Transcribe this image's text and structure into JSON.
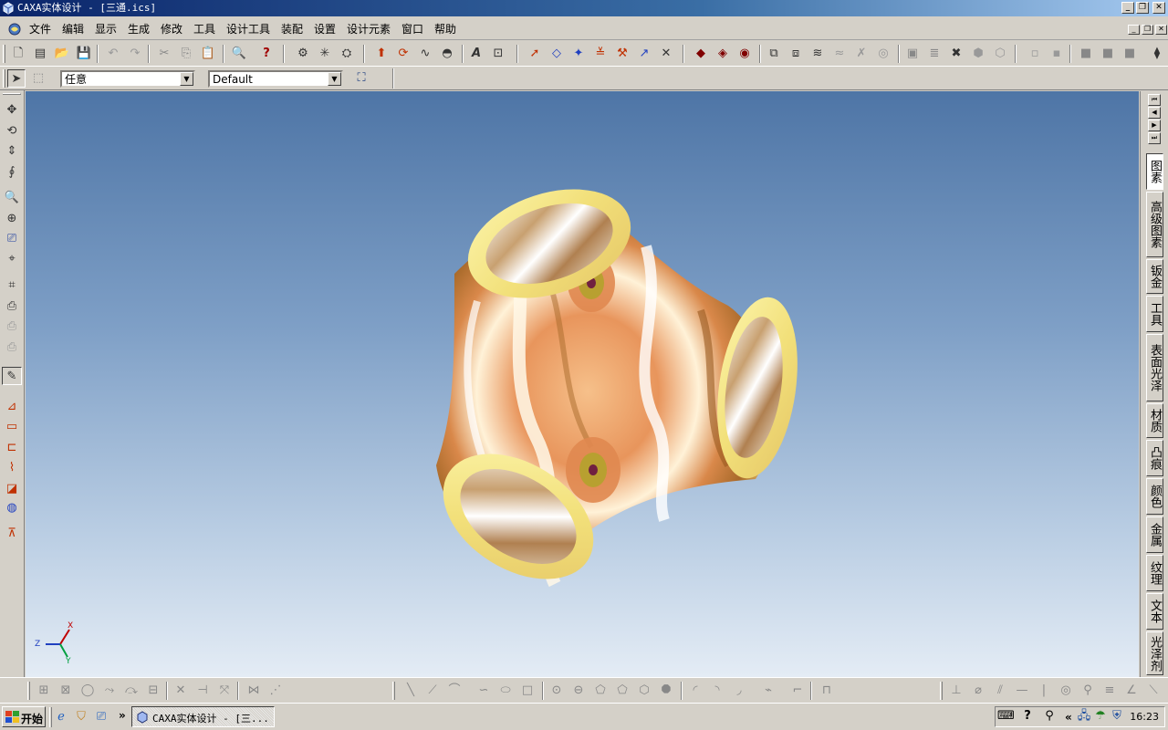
{
  "window": {
    "title": "CAXA实体设计 - [三通.ics]",
    "minimize_symbol": "_",
    "restore_symbol": "❐",
    "close_symbol": "✕"
  },
  "menu": {
    "items": [
      "文件",
      "编辑",
      "显示",
      "生成",
      "修改",
      "工具",
      "设计工具",
      "装配",
      "设置",
      "设计元素",
      "窗口",
      "帮助"
    ]
  },
  "selector": {
    "filter_value": "任意",
    "style_value": "Default"
  },
  "axes": {
    "x": "X",
    "y": "Y",
    "z": "Z"
  },
  "right_panel": {
    "tabs": [
      "图素",
      "高级图素",
      "钣金",
      "工具",
      "表面光泽",
      "材质",
      "凸痕",
      "颜色",
      "金属",
      "纹理",
      "文本",
      "光泽剂"
    ]
  },
  "taskbar": {
    "start_label": "开始",
    "chevron": "»",
    "task_label": "CAXA实体设计 - [三...",
    "tray_chevron": "«",
    "clock": "16:23"
  },
  "colors": {
    "title_start": "#0a246a",
    "title_end": "#a6caf0",
    "viewport_top": "#4e75a6",
    "viewport_bottom": "#e4ecf5",
    "rim": "#f4e68a",
    "body": "#e9995e"
  }
}
